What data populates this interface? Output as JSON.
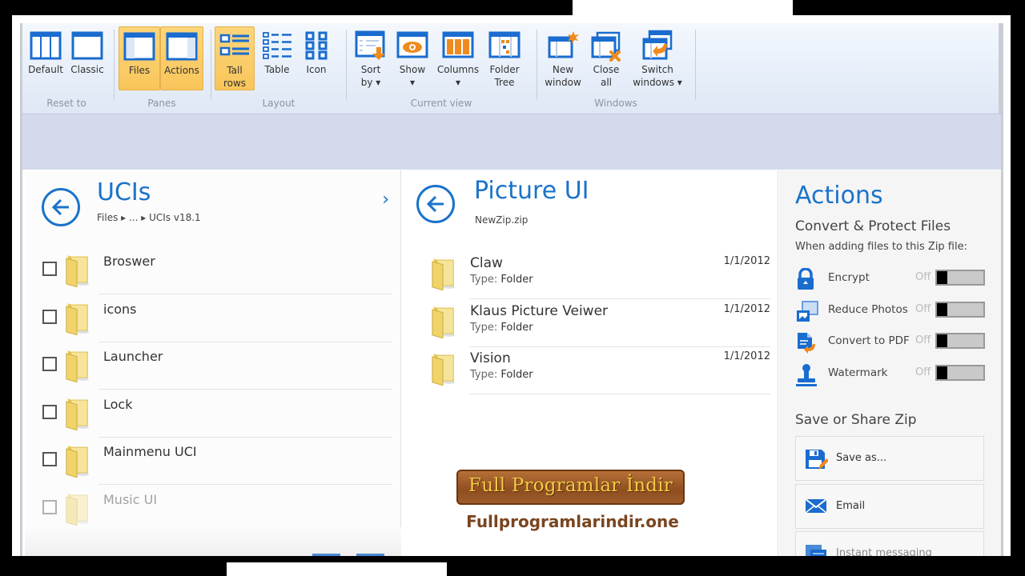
{
  "ribbon": {
    "groups": [
      {
        "label": "Reset to",
        "buttons": [
          {
            "label": "Default",
            "icon": "layout-three-pane-icon"
          },
          {
            "label": "Classic",
            "icon": "layout-single-pane-icon"
          }
        ]
      },
      {
        "label": "Panes",
        "buttons": [
          {
            "label": "Files",
            "icon": "files-pane-icon",
            "active": true
          },
          {
            "label": "Actions",
            "icon": "actions-pane-icon",
            "active": true
          }
        ]
      },
      {
        "label": "Layout",
        "buttons": [
          {
            "label": "Tall\nrows",
            "icon": "tall-rows-icon",
            "active": true
          },
          {
            "label": "Table",
            "icon": "table-icon"
          },
          {
            "label": "Icon",
            "icon": "icon-grid-icon"
          }
        ]
      },
      {
        "label": "Current view",
        "buttons": [
          {
            "label": "Sort\nby ▾",
            "icon": "sort-icon"
          },
          {
            "label": "Show\n▾",
            "icon": "eye-icon"
          },
          {
            "label": "Columns\n▾",
            "icon": "columns-icon"
          },
          {
            "label": "Folder\nTree",
            "icon": "folder-tree-icon"
          }
        ]
      },
      {
        "label": "Windows",
        "buttons": [
          {
            "label": "New\nwindow",
            "icon": "new-window-icon"
          },
          {
            "label": "Close\nall",
            "icon": "close-all-icon"
          },
          {
            "label": "Switch\nwindows ▾",
            "icon": "switch-windows-icon"
          }
        ]
      }
    ]
  },
  "left_pane": {
    "title": "UCIs",
    "breadcrumb": "Files ▸ ... ▸ UCIs v18.1",
    "forward_icon": "›",
    "items": [
      {
        "name": "Broswer"
      },
      {
        "name": "icons"
      },
      {
        "name": "Launcher"
      },
      {
        "name": "Lock"
      },
      {
        "name": "Mainmenu UCI"
      },
      {
        "name": "Music UI"
      }
    ]
  },
  "middle_pane": {
    "title": "Picture UI",
    "subtitle": "NewZip.zip",
    "type_key": "Type:",
    "items": [
      {
        "name": "Claw",
        "type": "Folder",
        "date": "1/1/2012"
      },
      {
        "name": "Klaus Picture Veiwer",
        "type": "Folder",
        "date": "1/1/2012"
      },
      {
        "name": "Vision",
        "type": "Folder",
        "date": "1/1/2012"
      }
    ]
  },
  "actions_pane": {
    "title": "Actions",
    "convert_heading": "Convert & Protect Files",
    "convert_note": "When adding files to this Zip file:",
    "toggles": [
      {
        "label": "Encrypt",
        "state": "Off",
        "icon": "lock-icon"
      },
      {
        "label": "Reduce Photos",
        "state": "Off",
        "icon": "photos-icon"
      },
      {
        "label": "Convert to PDF",
        "state": "Off",
        "icon": "pdf-convert-icon"
      },
      {
        "label": "Watermark",
        "state": "Off",
        "icon": "stamp-icon"
      }
    ],
    "share_heading": "Save or Share Zip",
    "share_buttons": [
      {
        "label": "Save as...",
        "icon": "save-icon"
      },
      {
        "label": "Email",
        "icon": "email-icon"
      },
      {
        "label": "Instant messaging",
        "icon": "im-icon"
      }
    ]
  },
  "watermark": {
    "logo_text": "Full Programlar İndir",
    "url": "Fullprogramlarindir.one"
  },
  "colors": {
    "accent": "#1a73c9",
    "active_button": "#f9c55a",
    "icon_orange": "#f08a1c"
  }
}
